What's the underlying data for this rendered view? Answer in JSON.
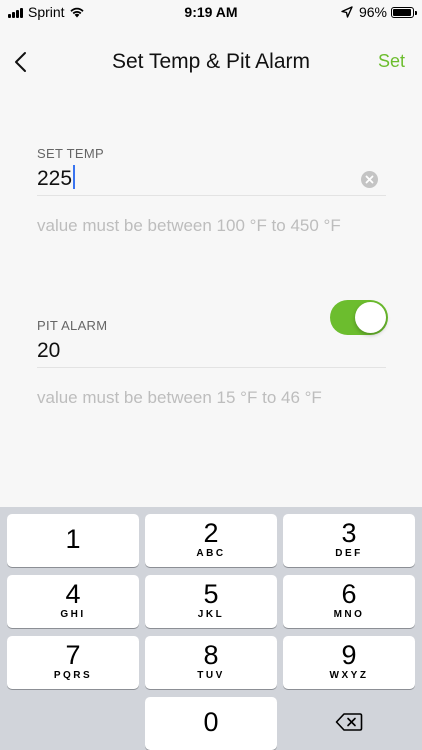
{
  "status_bar": {
    "carrier": "Sprint",
    "time": "9:19 AM",
    "battery_percent": "96%",
    "battery_level": 0.96
  },
  "nav": {
    "title": "Set Temp & Pit Alarm",
    "action_label": "Set",
    "back_icon": "chevron-left-icon"
  },
  "set_temp": {
    "label": "SET TEMP",
    "value": "225",
    "hint": "value must be between 100 °F to 450 °F"
  },
  "pit_alarm": {
    "label": "PIT ALARM",
    "value": "20",
    "enabled": true,
    "hint": "value must be between 15 °F to 46 °F"
  },
  "keypad": {
    "keys": [
      {
        "digit": "1",
        "letters": ""
      },
      {
        "digit": "2",
        "letters": "ABC"
      },
      {
        "digit": "3",
        "letters": "DEF"
      },
      {
        "digit": "4",
        "letters": "GHI"
      },
      {
        "digit": "5",
        "letters": "JKL"
      },
      {
        "digit": "6",
        "letters": "MNO"
      },
      {
        "digit": "7",
        "letters": "PQRS"
      },
      {
        "digit": "8",
        "letters": "TUV"
      },
      {
        "digit": "9",
        "letters": "WXYZ"
      },
      {
        "digit": "0",
        "letters": ""
      }
    ]
  },
  "colors": {
    "accent": "#6cbd2e",
    "caret": "#3a74f0",
    "hint": "#bdbdbd",
    "keypad_bg": "#d1d4da"
  }
}
